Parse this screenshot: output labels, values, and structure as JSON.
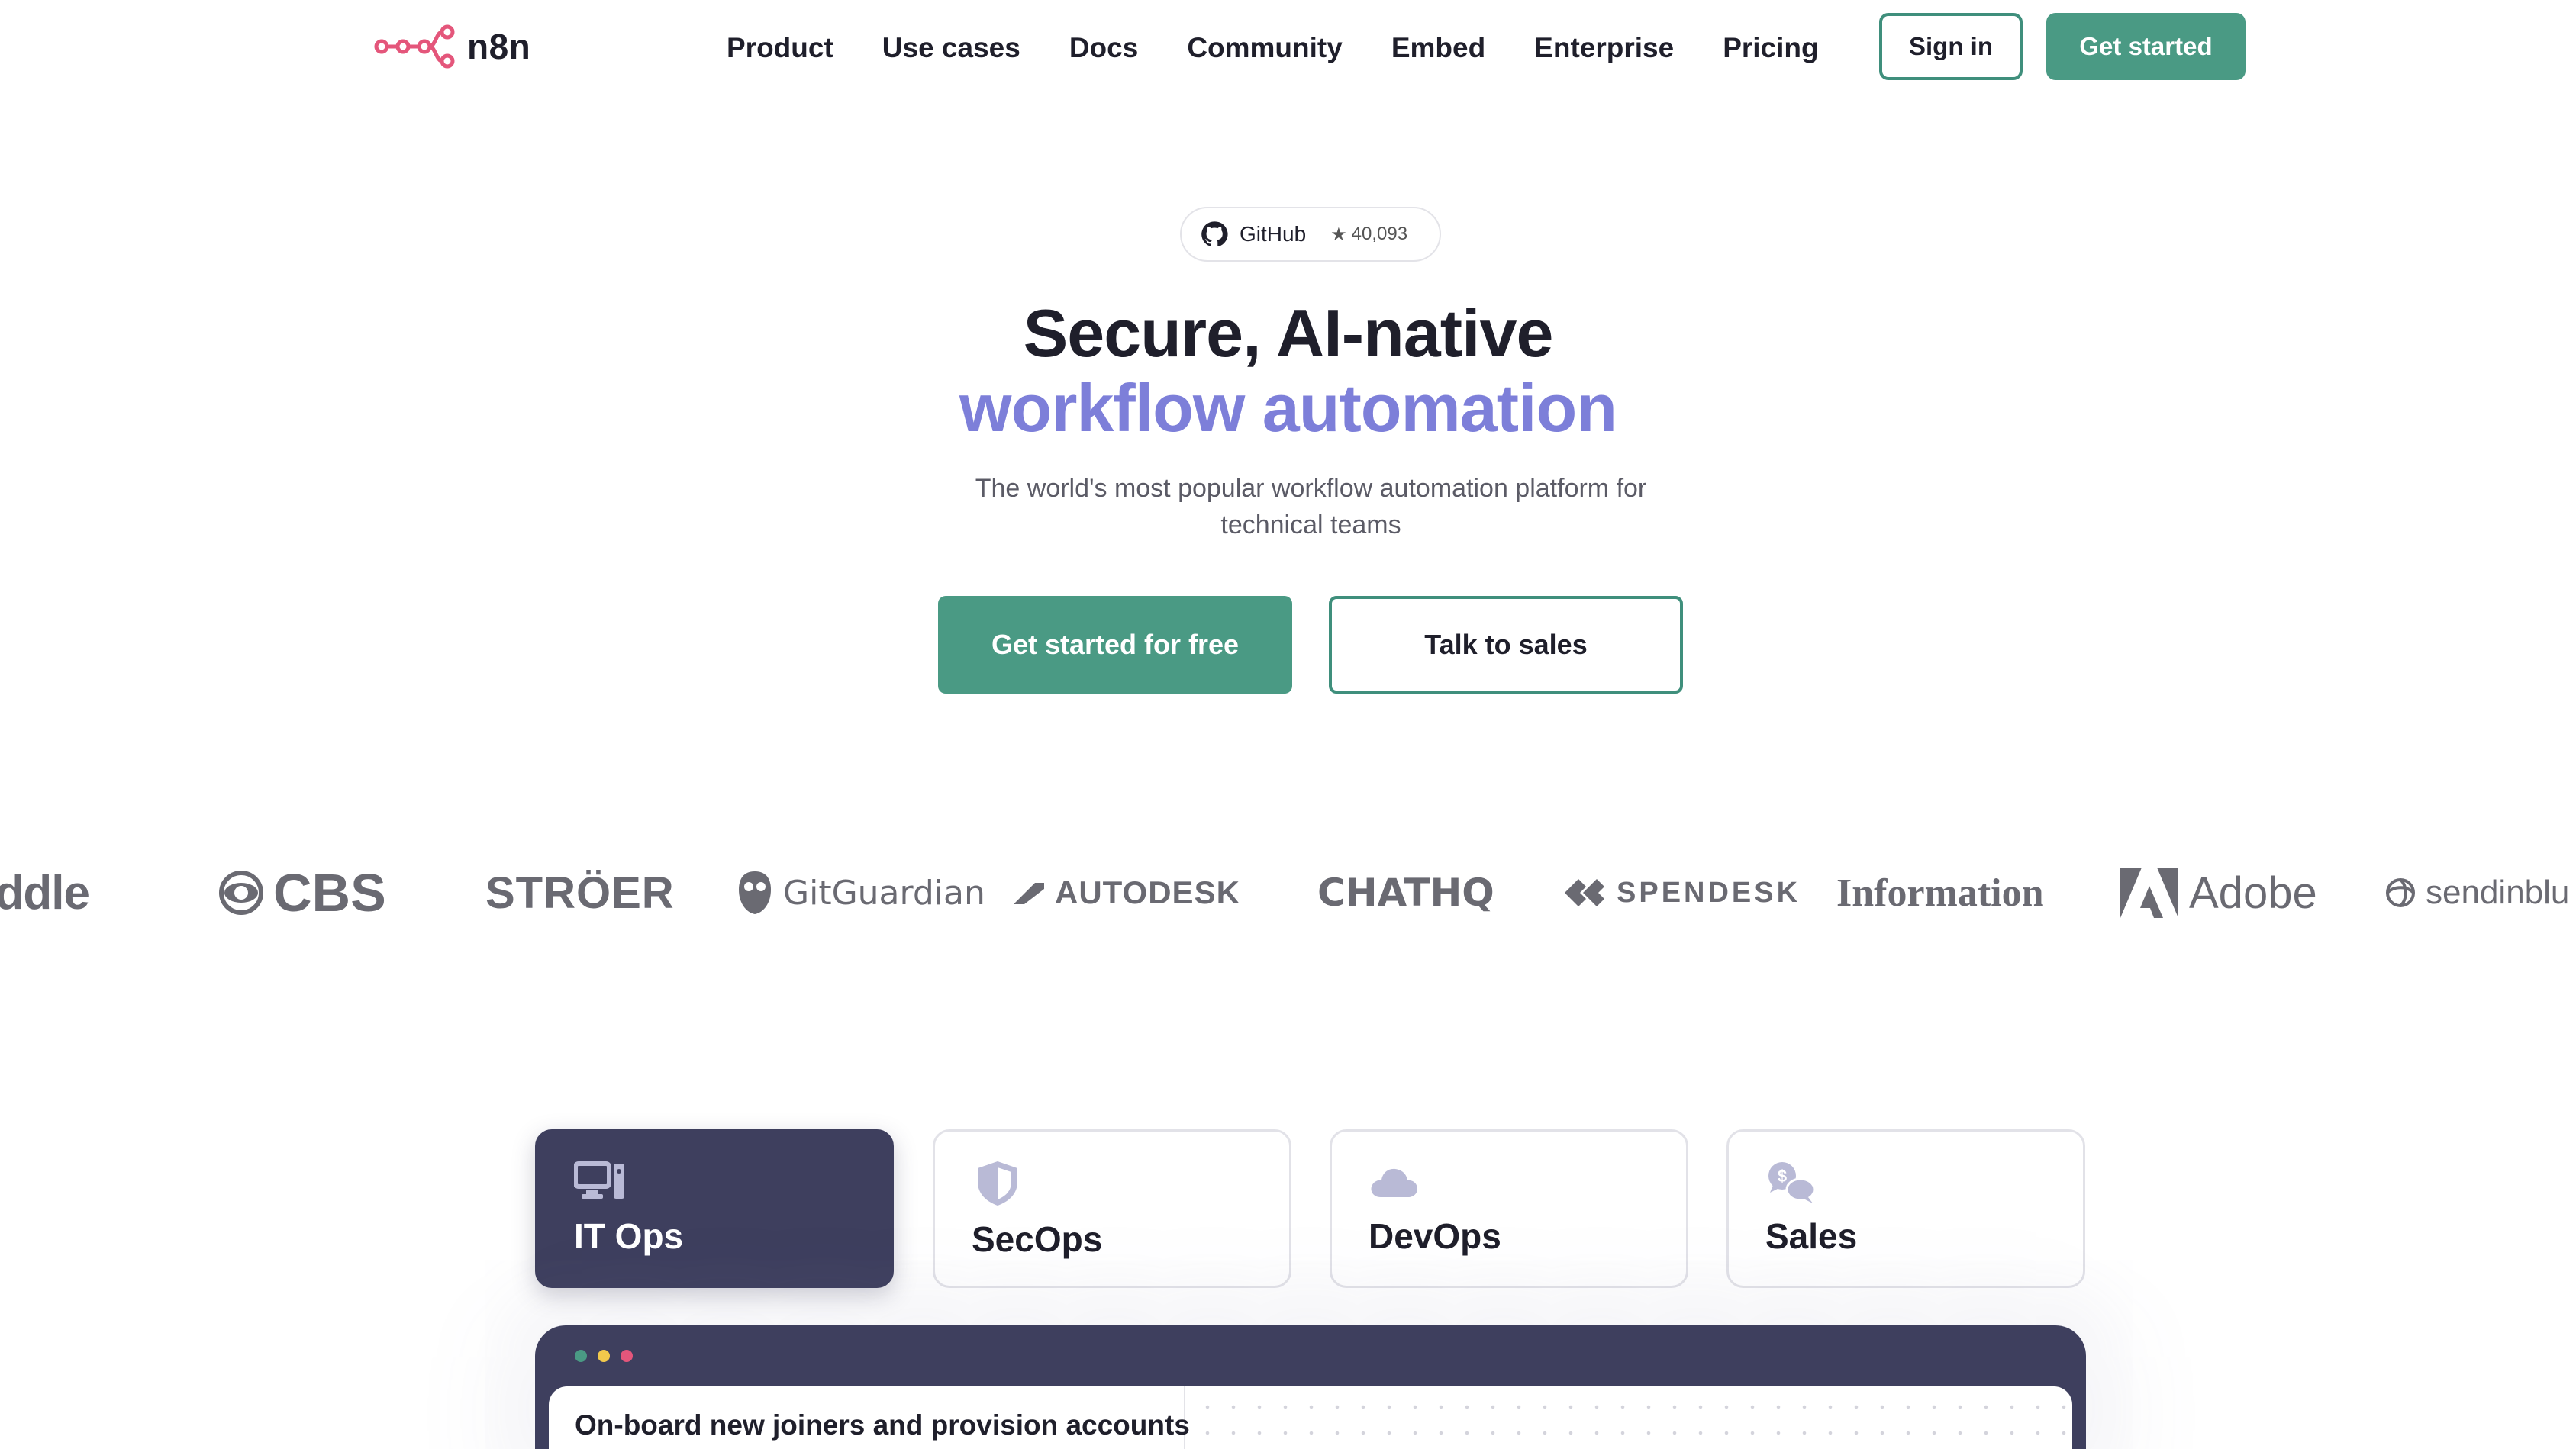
{
  "brand": {
    "name": "n8n",
    "accent": "#e4567b"
  },
  "nav": {
    "items": [
      "Product",
      "Use cases",
      "Docs",
      "Community",
      "Embed",
      "Enterprise",
      "Pricing"
    ],
    "signin_label": "Sign in",
    "getstarted_label": "Get started"
  },
  "hero": {
    "github_label": "GitHub",
    "github_stars": "40,093",
    "title_line1": "Secure, AI-native",
    "title_line2": "workflow automation",
    "subtitle": "The world's most popular workflow automation platform for technical teams",
    "cta_primary": "Get started for free",
    "cta_secondary": "Talk to sales"
  },
  "logos": [
    "Paddle",
    "CBS",
    "STRÖER",
    "GitGuardian",
    "AUTODESK",
    "CHATHQ",
    "SPENDESK",
    "Information",
    "Adobe",
    "sendinblue"
  ],
  "logo_strip": {
    "paddle": "addle",
    "cbs": "CBS",
    "stroer": "STRÖER",
    "gitguardian": "GitGuardian",
    "autodesk": "AUTODESK",
    "chathq": "CHATHQ",
    "spendesk": "SPENDESK",
    "information": "Information",
    "adobe": "Adobe",
    "sendinblue": "sendinblu"
  },
  "tabs": [
    {
      "label": "IT Ops",
      "icon": "computer-icon",
      "active": true
    },
    {
      "label": "SecOps",
      "icon": "shield-icon",
      "active": false
    },
    {
      "label": "DevOps",
      "icon": "cloud-icon",
      "active": false
    },
    {
      "label": "Sales",
      "icon": "chat-dollar-icon",
      "active": false
    }
  ],
  "demo": {
    "window_dots": [
      "#4a9a84",
      "#f2c94c",
      "#e4567b"
    ],
    "workflow_title": "On-board new joiners and provision accounts"
  },
  "colors": {
    "primary_green": "#4a9a84",
    "hero_accent": "#7d7fd9",
    "tab_active_bg": "#3e3f5e"
  }
}
